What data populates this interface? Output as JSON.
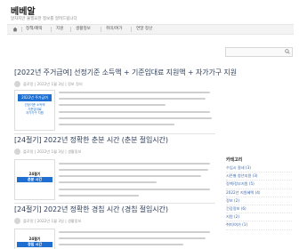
{
  "site": {
    "title": "베베알",
    "description": "알차지만 불필요한 정보를 알려드립니다"
  },
  "nav": [
    {
      "label": "정책/혜택"
    },
    {
      "label": "지원"
    },
    {
      "label": "생활정보"
    },
    {
      "label": "취미/여가"
    },
    {
      "label": "연말 정산"
    }
  ],
  "sidebar": {
    "heading": "카테고리",
    "items": [
      "수입시 절세 (3)",
      "시즌별 청년지원 (3)",
      "정책/정부지원 (5)",
      "2022년 지원혜택 (4)",
      "정보 (2)",
      "건강정보 (6)",
      "지원 (2)",
      "취미/여가 (1)"
    ]
  },
  "posts": [
    {
      "title": "[2022년 주거급여] 선정기준 소득액 + 기준임대료 지원액 + 자가가구 지원",
      "author": "플로망",
      "date": "2022년 1월 3일",
      "category": "정보 정리",
      "thumb_lines": [
        "2022년 주거급여",
        "선정기준 소득액",
        "기준임대료",
        "자가가구 지원"
      ]
    },
    {
      "title": "[24절기] 2022년 정확한 춘분 시간 (춘분 절입시간)",
      "author": "플로망",
      "date": "2022년 1월 3일",
      "category": "생활정보",
      "thumb_lines": [
        "24절기",
        "춘분 시간"
      ]
    },
    {
      "title": "[24절기] 2022년 정확한 경칩 시간 (경칩 절입시간)",
      "author": "플로망",
      "date": "2022년 1월 3일",
      "category": "생활정보",
      "thumb_lines": [
        "24절기",
        "경칩 시간"
      ]
    }
  ],
  "colors": {
    "accent": "#2d3d5a",
    "link": "#3a66a8",
    "thumb_blue": "#1f6fd0"
  }
}
